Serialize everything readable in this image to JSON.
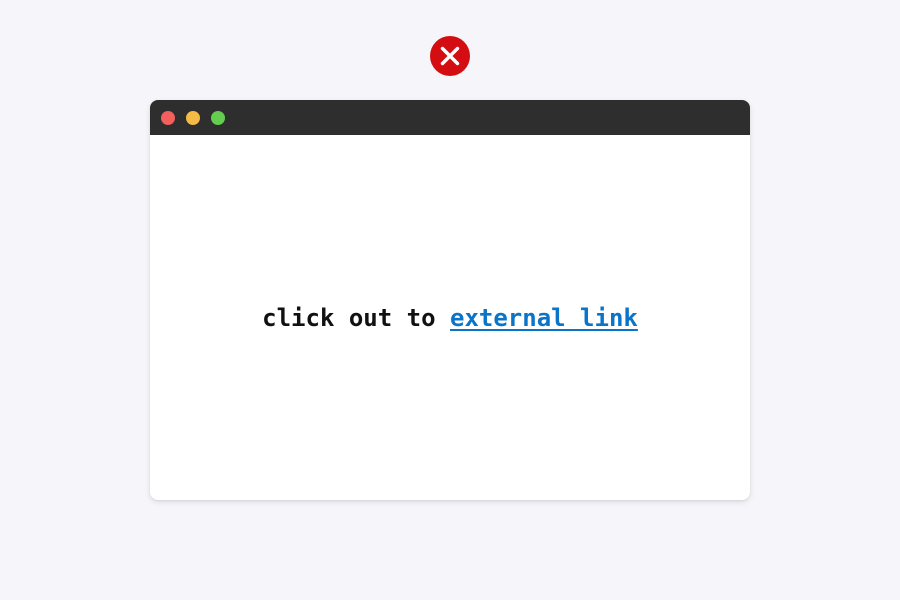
{
  "status_icon": "close-circle-icon",
  "window": {
    "controls": [
      "close-button",
      "minimize-button",
      "maximize-button"
    ],
    "message": {
      "prefix": "click out to ",
      "link_text": "external link"
    }
  },
  "colors": {
    "background": "#f6f5fa",
    "error_red": "#d40d12",
    "titlebar": "#2e2e2e",
    "traffic_red": "#f25f5c",
    "traffic_yellow": "#f5b945",
    "traffic_green": "#64cd4f",
    "link": "#0a74c9"
  }
}
